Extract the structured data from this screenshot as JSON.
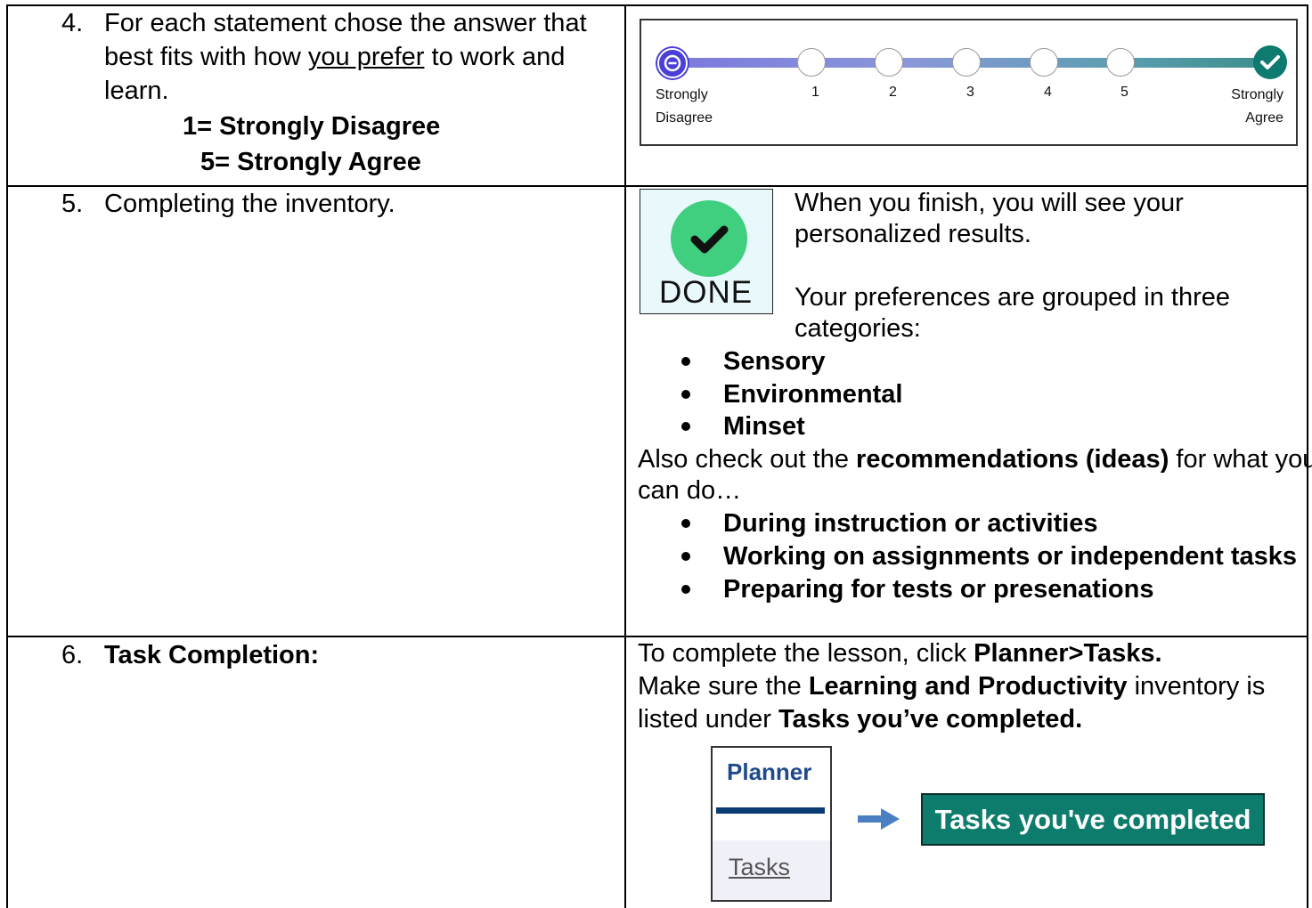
{
  "rows": [
    {
      "number": "4.",
      "instruction": {
        "line1": "For each statement chose the answer that",
        "line2_pre": "best fits with how ",
        "line2_underline": "you prefer",
        "line2_post": " to work and",
        "line3": "learn."
      },
      "scale_key": [
        "1= Strongly Disagree",
        "5= Strongly Agree"
      ],
      "likert_scale": {
        "left_label": [
          "Strongly",
          "Disagree"
        ],
        "right_label": [
          "Strongly",
          "Agree"
        ],
        "points": [
          "1",
          "2",
          "3",
          "4",
          "5"
        ],
        "selected": "Strongly Agree",
        "colors": {
          "track_start": "#7b79dd",
          "track_end": "#3d8e8c",
          "left_node": "#4b3fd8",
          "right_node": "#0e7a70"
        }
      }
    },
    {
      "number": "5.",
      "instruction": "Completing the inventory.",
      "done_image": {
        "label": "DONE",
        "icon": "check-circle-icon",
        "color": "#3fcf7e"
      },
      "intro": [
        "When you finish, you will see your",
        "personalized results."
      ],
      "categories_intro": [
        "Your preferences are grouped in three",
        "categories:"
      ],
      "categories": [
        "Sensory",
        "Environmental",
        "Minset"
      ],
      "recommendations": {
        "pre": "Also check out the ",
        "bold": "recommendations (ideas)",
        "post": " for what you",
        "line2": "can do…"
      },
      "recommendation_items": [
        "During instruction or activities",
        "Working on assignments or independent tasks",
        "Preparing for tests or presenations"
      ]
    },
    {
      "number": "6.",
      "instruction": "Task Completion:",
      "line1": {
        "pre": "To complete the lesson, click ",
        "bold": "Planner>Tasks."
      },
      "line2": {
        "pre": "Make sure the ",
        "bold": "Learning and Productivity",
        "post": " inventory is"
      },
      "line3": {
        "pre": "listed under ",
        "bold": "Tasks you’ve completed."
      },
      "planner_image": {
        "title": "Planner",
        "tab": "Tasks",
        "colors": {
          "title": "#1f4a8a",
          "bar": "#0b3b73"
        }
      },
      "arrow_icon": "right-arrow-icon",
      "completed_button": {
        "label": "Tasks you've completed",
        "color": "#0e7c6c"
      }
    }
  ]
}
